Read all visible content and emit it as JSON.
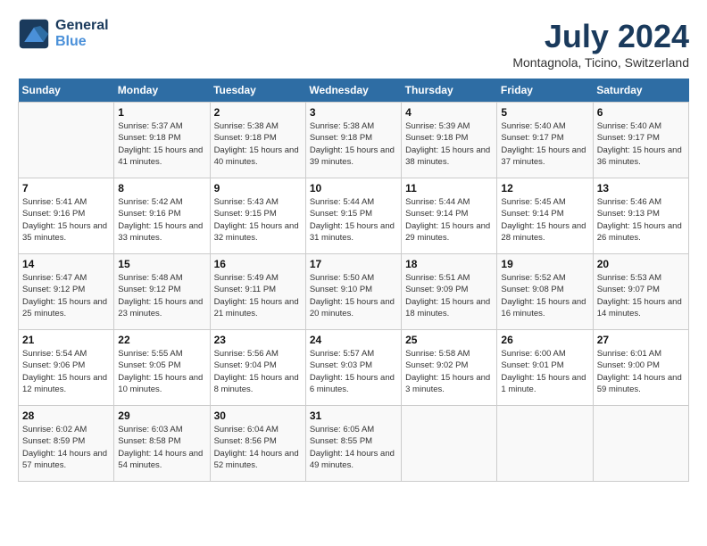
{
  "header": {
    "logo_line1": "General",
    "logo_line2": "Blue",
    "month_year": "July 2024",
    "location": "Montagnola, Ticino, Switzerland"
  },
  "weekdays": [
    "Sunday",
    "Monday",
    "Tuesday",
    "Wednesday",
    "Thursday",
    "Friday",
    "Saturday"
  ],
  "weeks": [
    [
      null,
      {
        "day": 1,
        "sunrise": "5:37 AM",
        "sunset": "9:18 PM",
        "daylight": "15 hours and 41 minutes."
      },
      {
        "day": 2,
        "sunrise": "5:38 AM",
        "sunset": "9:18 PM",
        "daylight": "15 hours and 40 minutes."
      },
      {
        "day": 3,
        "sunrise": "5:38 AM",
        "sunset": "9:18 PM",
        "daylight": "15 hours and 39 minutes."
      },
      {
        "day": 4,
        "sunrise": "5:39 AM",
        "sunset": "9:18 PM",
        "daylight": "15 hours and 38 minutes."
      },
      {
        "day": 5,
        "sunrise": "5:40 AM",
        "sunset": "9:17 PM",
        "daylight": "15 hours and 37 minutes."
      },
      {
        "day": 6,
        "sunrise": "5:40 AM",
        "sunset": "9:17 PM",
        "daylight": "15 hours and 36 minutes."
      }
    ],
    [
      {
        "day": 7,
        "sunrise": "5:41 AM",
        "sunset": "9:16 PM",
        "daylight": "15 hours and 35 minutes."
      },
      {
        "day": 8,
        "sunrise": "5:42 AM",
        "sunset": "9:16 PM",
        "daylight": "15 hours and 33 minutes."
      },
      {
        "day": 9,
        "sunrise": "5:43 AM",
        "sunset": "9:15 PM",
        "daylight": "15 hours and 32 minutes."
      },
      {
        "day": 10,
        "sunrise": "5:44 AM",
        "sunset": "9:15 PM",
        "daylight": "15 hours and 31 minutes."
      },
      {
        "day": 11,
        "sunrise": "5:44 AM",
        "sunset": "9:14 PM",
        "daylight": "15 hours and 29 minutes."
      },
      {
        "day": 12,
        "sunrise": "5:45 AM",
        "sunset": "9:14 PM",
        "daylight": "15 hours and 28 minutes."
      },
      {
        "day": 13,
        "sunrise": "5:46 AM",
        "sunset": "9:13 PM",
        "daylight": "15 hours and 26 minutes."
      }
    ],
    [
      {
        "day": 14,
        "sunrise": "5:47 AM",
        "sunset": "9:12 PM",
        "daylight": "15 hours and 25 minutes."
      },
      {
        "day": 15,
        "sunrise": "5:48 AM",
        "sunset": "9:12 PM",
        "daylight": "15 hours and 23 minutes."
      },
      {
        "day": 16,
        "sunrise": "5:49 AM",
        "sunset": "9:11 PM",
        "daylight": "15 hours and 21 minutes."
      },
      {
        "day": 17,
        "sunrise": "5:50 AM",
        "sunset": "9:10 PM",
        "daylight": "15 hours and 20 minutes."
      },
      {
        "day": 18,
        "sunrise": "5:51 AM",
        "sunset": "9:09 PM",
        "daylight": "15 hours and 18 minutes."
      },
      {
        "day": 19,
        "sunrise": "5:52 AM",
        "sunset": "9:08 PM",
        "daylight": "15 hours and 16 minutes."
      },
      {
        "day": 20,
        "sunrise": "5:53 AM",
        "sunset": "9:07 PM",
        "daylight": "15 hours and 14 minutes."
      }
    ],
    [
      {
        "day": 21,
        "sunrise": "5:54 AM",
        "sunset": "9:06 PM",
        "daylight": "15 hours and 12 minutes."
      },
      {
        "day": 22,
        "sunrise": "5:55 AM",
        "sunset": "9:05 PM",
        "daylight": "15 hours and 10 minutes."
      },
      {
        "day": 23,
        "sunrise": "5:56 AM",
        "sunset": "9:04 PM",
        "daylight": "15 hours and 8 minutes."
      },
      {
        "day": 24,
        "sunrise": "5:57 AM",
        "sunset": "9:03 PM",
        "daylight": "15 hours and 6 minutes."
      },
      {
        "day": 25,
        "sunrise": "5:58 AM",
        "sunset": "9:02 PM",
        "daylight": "15 hours and 3 minutes."
      },
      {
        "day": 26,
        "sunrise": "6:00 AM",
        "sunset": "9:01 PM",
        "daylight": "15 hours and 1 minute."
      },
      {
        "day": 27,
        "sunrise": "6:01 AM",
        "sunset": "9:00 PM",
        "daylight": "14 hours and 59 minutes."
      }
    ],
    [
      {
        "day": 28,
        "sunrise": "6:02 AM",
        "sunset": "8:59 PM",
        "daylight": "14 hours and 57 minutes."
      },
      {
        "day": 29,
        "sunrise": "6:03 AM",
        "sunset": "8:58 PM",
        "daylight": "14 hours and 54 minutes."
      },
      {
        "day": 30,
        "sunrise": "6:04 AM",
        "sunset": "8:56 PM",
        "daylight": "14 hours and 52 minutes."
      },
      {
        "day": 31,
        "sunrise": "6:05 AM",
        "sunset": "8:55 PM",
        "daylight": "14 hours and 49 minutes."
      },
      null,
      null,
      null
    ]
  ]
}
